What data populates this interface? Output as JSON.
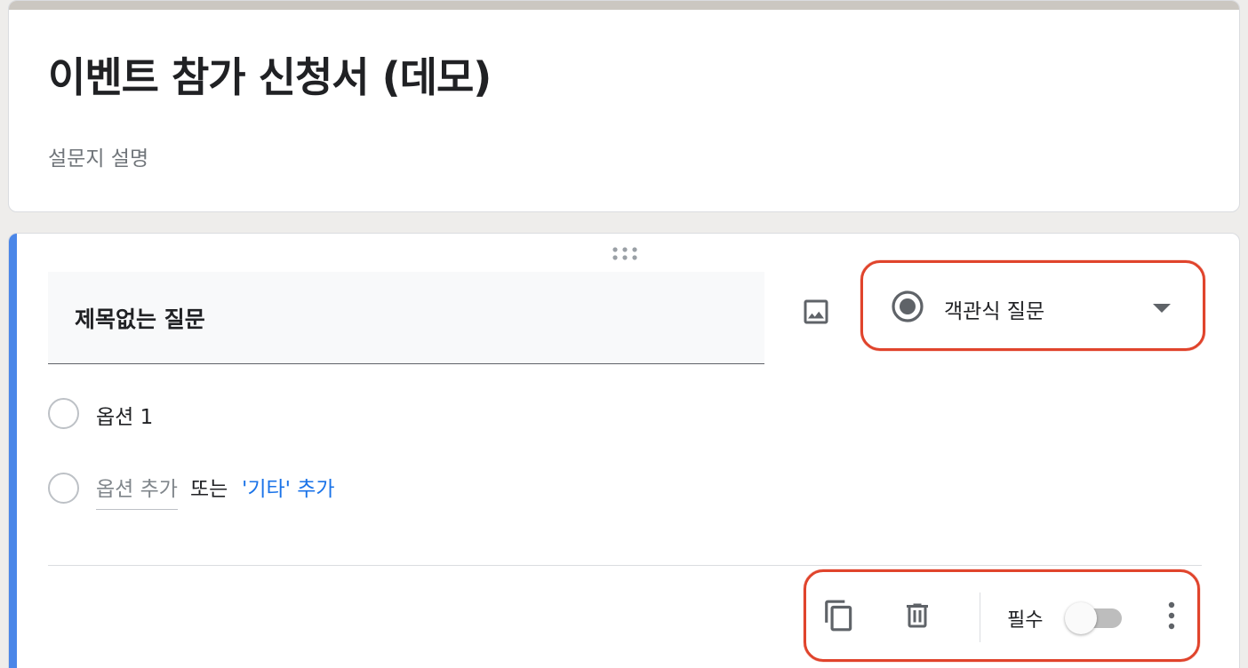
{
  "form": {
    "title": "이벤트 참가 신청서 (데모)",
    "description": "설문지 설명"
  },
  "question": {
    "title": "제목없는 질문",
    "type_label": "객관식 질문",
    "options": [
      {
        "label": "옵션 1"
      }
    ],
    "add_option_placeholder": "옵션 추가",
    "or_text": "또는",
    "add_other_label": "'기타' 추가",
    "required_label": "필수",
    "required_on": false
  },
  "icons": {
    "drag": "drag-handle-icon",
    "image": "image-icon",
    "type": "radio-button-checked-icon",
    "dropdown": "chevron-down-icon",
    "duplicate": "copy-icon",
    "delete": "trash-icon",
    "more": "more-vert-icon"
  },
  "colors": {
    "accent": "#4a86e8",
    "link": "#1a73e8",
    "annotation": "#e0442c",
    "header_strip": "#cbc7c1"
  }
}
